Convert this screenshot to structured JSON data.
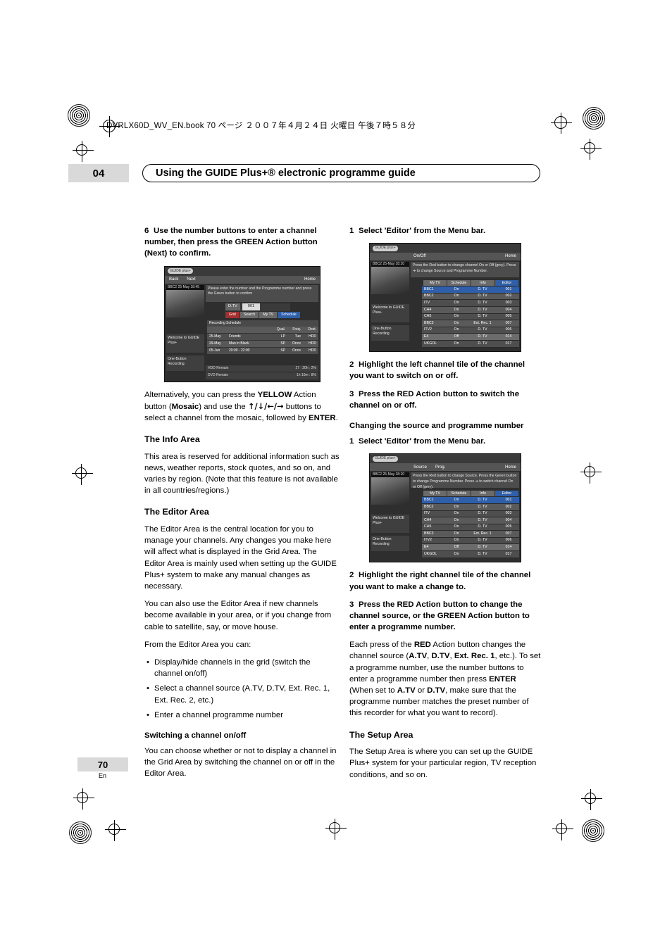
{
  "header": {
    "filenote_main": "DVRLX60D_WV_EN.book  70 ",
    "filenote_jp": "ページ ２００７年４月２４日 火曜日 午後７時５８分"
  },
  "chapter": {
    "number": "04",
    "title": "Using the GUIDE Plus+® electronic programme guide"
  },
  "footer": {
    "page": "70",
    "lang": "En"
  },
  "left_column": {
    "step6": "Use the number buttons to enter a channel number, then press the GREEN Action button (Next) to confirm.",
    "step6_num": "6",
    "alt_text_1": "Alternatively, you can press the ",
    "alt_yellow": "YELLOW",
    "alt_text_2": " Action button (",
    "alt_mosaic": "Mosaic",
    "alt_text_3": ") and use the ",
    "alt_arrows": "↑/↓/←/→",
    "alt_text_4": " buttons to select a channel from the mosaic, followed by ",
    "alt_enter": "ENTER",
    "alt_text_5": ".",
    "info_heading": "The Info Area",
    "info_body": "This area is reserved for additional information such as news, weather reports, stock quotes, and so on, and varies by region. (Note that this feature is not available in all countries/regions.)",
    "editor_heading": "The Editor Area",
    "editor_body1": "The Editor Area is the central location for you to manage your channels. Any changes you make here will affect what is displayed in the Grid Area. The Editor Area is mainly used when setting up the GUIDE Plus+ system to make any manual changes as necessary.",
    "editor_body2": "You can also use the Editor Area if new channels become available in your area, or if you change from cable to satellite, say, or move house.",
    "editor_body3": "From the Editor Area you can:",
    "bullets": [
      "Display/hide channels in the grid (switch the channel on/off)",
      "Select a channel source (A.TV, D.TV, Ext. Rec. 1, Ext. Rec. 2, etc.)",
      "Enter a channel programme number"
    ],
    "switching_heading": "Switching a channel on/off",
    "switching_body": "You can choose whether or not to display a channel in the Grid Area by switching the channel on or off in the Editor Area."
  },
  "right_column": {
    "step1_num": "1",
    "step1": "Select 'Editor' from the Menu bar.",
    "step2_num": "2",
    "step2": "Highlight the left channel tile of the channel you want to switch on or off.",
    "step3_num": "3",
    "step3": "Press the RED Action button to switch the channel on or off.",
    "changing_heading": "Changing the source and programme number",
    "c_step1_num": "1",
    "c_step1": "Select 'Editor' from the Menu bar.",
    "c_step2_num": "2",
    "c_step2": "Highlight the right channel tile of the channel you want to make a change to.",
    "c_step3_num": "3",
    "c_step3": "Press the RED Action button to change the channel source, or the GREEN Action button to enter a programme number.",
    "c_body_1": "Each press of the ",
    "c_body_red": "RED",
    "c_body_2": " Action button changes the channel source (",
    "c_body_atv": "A.TV",
    "c_body_3": ", ",
    "c_body_dtv": "D.TV",
    "c_body_4": ", ",
    "c_body_ext1": "Ext. Rec. 1",
    "c_body_5": ", etc.). To set a programme number, use the number buttons to enter a programme number then press ",
    "c_body_enter": "ENTER",
    "c_body_6": " (When set to ",
    "c_body_atv2": "A.TV",
    "c_body_7": " or ",
    "c_body_dtv2": "D.TV",
    "c_body_8": ", make sure that the programme number matches the preset number of this recorder for what you want to record).",
    "setup_heading": "The Setup Area",
    "setup_body": "The Setup Area is where you can set up the GUIDE Plus+ system for your particular region, TV reception conditions, and so on."
  },
  "screenshot_step6": {
    "logo": "GUIDE plus+",
    "menu": [
      "Back",
      "Next",
      "Home"
    ],
    "date_overlay": "BBC2  25-May  18:45",
    "panel_text": "Please enter the number and the Programme number and press the Green button to confirm",
    "entry_label": "D.TV",
    "entry_value": "001",
    "buttons": [
      "Grid",
      "Search",
      "My TV",
      "Schedule"
    ],
    "sched_header": "Recording Schedule",
    "sched_cols": [
      "Qual.",
      "Freq.",
      "Dest."
    ],
    "sched_rows": [
      {
        "date": "25-May",
        "title": "Friends",
        "q": "LP",
        "f": "Tue",
        "d": "HDD"
      },
      {
        "date": "29-May",
        "title": "Man in Black",
        "q": "SP",
        "f": "Once",
        "d": "HDD"
      },
      {
        "date": "05-Jun",
        "title": "20:00 - 22:00",
        "q": "SP",
        "f": "Once",
        "d": "HDD"
      }
    ],
    "foot_rows": [
      {
        "l": "HDD Remain",
        "r": "27 : 20h : 2%"
      },
      {
        "l": "DVD Remain",
        "r": "1h 10m : 8%"
      }
    ],
    "welcome": "Welcome to GUIDE Plus+",
    "onebutton": "One-Button Recording"
  },
  "screenshot_onoff": {
    "logo": "GUIDE plus+",
    "menu_left": "On/Off",
    "menu_right": "Home",
    "date_overlay": "BBC2  25-May  18:10",
    "message": "Press the Red button to change channel On or Off (grey). Press ➜ to change Source and Programme Number.",
    "tabs": [
      "My TV",
      "Schedule",
      "Info",
      "Editor"
    ],
    "active_tab": "Editor",
    "rows": [
      {
        "name": "BBC1",
        "state": "On",
        "source": "D. TV",
        "num": "001",
        "sel": true
      },
      {
        "name": "BBC2",
        "state": "On",
        "source": "D. TV",
        "num": "002",
        "sel": false
      },
      {
        "name": "ITV",
        "state": "On",
        "source": "D. TV",
        "num": "003",
        "sel": false
      },
      {
        "name": "CH4",
        "state": "On",
        "source": "D. TV",
        "num": "004",
        "sel": false
      },
      {
        "name": "CH5",
        "state": "On",
        "source": "D. TV",
        "num": "005",
        "sel": false
      },
      {
        "name": "BBC3",
        "state": "On",
        "source": "Ext. Rec. 1",
        "num": "007",
        "sel": false
      },
      {
        "name": "ITV2",
        "state": "On",
        "source": "D. TV",
        "num": "006",
        "sel": false
      },
      {
        "name": "E4",
        "state": "Off",
        "source": "D. TV",
        "num": "014",
        "sel": false
      },
      {
        "name": "UKGOL",
        "state": "On",
        "source": "D. TV",
        "num": "017",
        "sel": false
      }
    ],
    "welcome": "Welcome to GUIDE Plus+",
    "onebutton": "One-Button Recording"
  },
  "screenshot_source": {
    "logo": "GUIDE plus+",
    "menu": [
      "Source",
      "Prog.",
      "Home"
    ],
    "date_overlay": "BBC2  25-May  18:10",
    "message": "Press the Red button to change Source. Press the Green button to change Programme Number. Press ➜ to switch channel On or Off (grey).",
    "tabs": [
      "My TV",
      "Schedule",
      "Info",
      "Editor"
    ],
    "active_tab": "Editor",
    "rows": [
      {
        "name": "BBC1",
        "state": "On",
        "source": "D. TV",
        "num": "001",
        "sel": true
      },
      {
        "name": "BBC2",
        "state": "On",
        "source": "D. TV",
        "num": "002",
        "sel": false
      },
      {
        "name": "ITV",
        "state": "On",
        "source": "D. TV",
        "num": "003",
        "sel": false
      },
      {
        "name": "CH4",
        "state": "On",
        "source": "D. TV",
        "num": "004",
        "sel": false
      },
      {
        "name": "CH5",
        "state": "On",
        "source": "D. TV",
        "num": "005",
        "sel": false
      },
      {
        "name": "BBC3",
        "state": "On",
        "source": "Ext. Rec. 1",
        "num": "007",
        "sel": false
      },
      {
        "name": "ITV2",
        "state": "On",
        "source": "D. TV",
        "num": "006",
        "sel": false
      },
      {
        "name": "E4",
        "state": "Off",
        "source": "D. TV",
        "num": "014",
        "sel": false
      },
      {
        "name": "UKGOL",
        "state": "On",
        "source": "D. TV",
        "num": "017",
        "sel": false
      }
    ],
    "welcome": "Welcome to GUIDE Plus+",
    "onebutton": "One-Button Recording"
  }
}
